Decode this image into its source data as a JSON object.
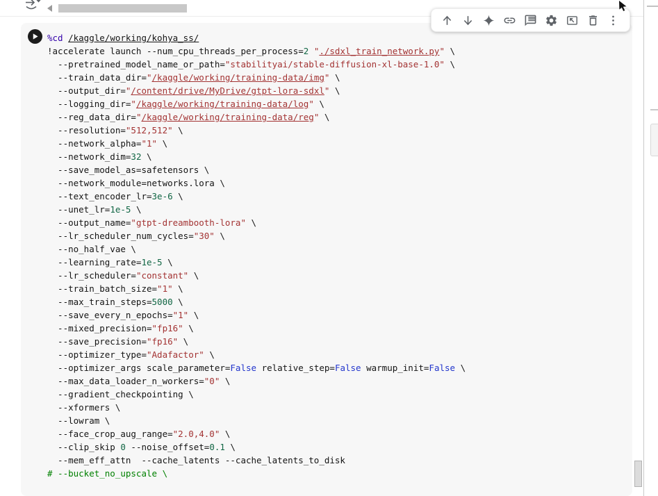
{
  "topbar": {
    "icons": [
      "run-section-arrow-icon",
      "hscroll-left-arrow-icon"
    ]
  },
  "cell_toolbar": {
    "icons": [
      {
        "name": "move-cell-up-icon"
      },
      {
        "name": "move-cell-down-icon"
      },
      {
        "name": "gemini-sparkle-icon"
      },
      {
        "name": "copy-link-icon"
      },
      {
        "name": "add-comment-icon"
      },
      {
        "name": "editor-settings-icon"
      },
      {
        "name": "mirror-cell-icon"
      },
      {
        "name": "delete-cell-icon"
      },
      {
        "name": "more-actions-icon"
      }
    ]
  },
  "colors": {
    "cell_background": "#f7f7f7",
    "icon_gray": "#5f6368",
    "token_string": "#a33333",
    "token_number": "#116644",
    "token_atom": "#2336cc",
    "token_comment": "#008000",
    "token_magic": "#3300aa",
    "token_plain": "#141414"
  },
  "cell": {
    "run_button": "run-cell",
    "code": {
      "lines": [
        [
          {
            "c": "magic",
            "s": "%cd"
          },
          {
            "c": "plain",
            "s": " "
          },
          {
            "c": "plain",
            "u": true,
            "s": "/kaggle/working/kohya_ss/"
          }
        ],
        [
          {
            "c": "plain",
            "s": "!accelerate launch --num_cpu_threads_per_process="
          },
          {
            "c": "number",
            "s": "2"
          },
          {
            "c": "plain",
            "s": " "
          },
          {
            "c": "string",
            "s": "\""
          },
          {
            "c": "string",
            "u": true,
            "s": "./sdxl_train_network.py"
          },
          {
            "c": "string",
            "s": "\""
          },
          {
            "c": "plain",
            "s": " \\"
          }
        ],
        [
          {
            "c": "plain",
            "s": "  --pretrained_model_name_or_path="
          },
          {
            "c": "string",
            "s": "\"stabilityai/stable-diffusion-xl-base-1.0\""
          },
          {
            "c": "plain",
            "s": " \\"
          }
        ],
        [
          {
            "c": "plain",
            "s": "  --train_data_dir="
          },
          {
            "c": "string",
            "s": "\""
          },
          {
            "c": "string",
            "u": true,
            "s": "/kaggle/working/training-data/img"
          },
          {
            "c": "string",
            "s": "\""
          },
          {
            "c": "plain",
            "s": " \\"
          }
        ],
        [
          {
            "c": "plain",
            "s": "  --output_dir="
          },
          {
            "c": "string",
            "s": "\""
          },
          {
            "c": "string",
            "u": true,
            "s": "/content/drive/MyDrive/gtpt-lora-sdxl"
          },
          {
            "c": "string",
            "s": "\""
          },
          {
            "c": "plain",
            "s": " \\"
          }
        ],
        [
          {
            "c": "plain",
            "s": "  --logging_dir="
          },
          {
            "c": "string",
            "s": "\""
          },
          {
            "c": "string",
            "u": true,
            "s": "/kaggle/working/training-data/log"
          },
          {
            "c": "string",
            "s": "\""
          },
          {
            "c": "plain",
            "s": " \\"
          }
        ],
        [
          {
            "c": "plain",
            "s": "  --reg_data_dir="
          },
          {
            "c": "string",
            "s": "\""
          },
          {
            "c": "string",
            "u": true,
            "s": "/kaggle/working/training-data/reg"
          },
          {
            "c": "string",
            "s": "\""
          },
          {
            "c": "plain",
            "s": " \\"
          }
        ],
        [
          {
            "c": "plain",
            "s": "  --resolution="
          },
          {
            "c": "string",
            "s": "\"512,512\""
          },
          {
            "c": "plain",
            "s": " \\"
          }
        ],
        [
          {
            "c": "plain",
            "s": "  --network_alpha="
          },
          {
            "c": "string",
            "s": "\"1\""
          },
          {
            "c": "plain",
            "s": " \\"
          }
        ],
        [
          {
            "c": "plain",
            "s": "  --network_dim="
          },
          {
            "c": "number",
            "s": "32"
          },
          {
            "c": "plain",
            "s": " \\"
          }
        ],
        [
          {
            "c": "plain",
            "s": "  --save_model_as=safetensors \\"
          }
        ],
        [
          {
            "c": "plain",
            "s": "  --network_module=networks.lora \\"
          }
        ],
        [
          {
            "c": "plain",
            "s": "  --text_encoder_lr="
          },
          {
            "c": "number",
            "s": "3e-6"
          },
          {
            "c": "plain",
            "s": " \\"
          }
        ],
        [
          {
            "c": "plain",
            "s": "  --unet_lr="
          },
          {
            "c": "number",
            "s": "1e-5"
          },
          {
            "c": "plain",
            "s": " \\"
          }
        ],
        [
          {
            "c": "plain",
            "s": "  --output_name="
          },
          {
            "c": "string",
            "s": "\"gtpt-dreambooth-lora\""
          },
          {
            "c": "plain",
            "s": " \\"
          }
        ],
        [
          {
            "c": "plain",
            "s": "  --lr_scheduler_num_cycles="
          },
          {
            "c": "string",
            "s": "\"30\""
          },
          {
            "c": "plain",
            "s": " \\"
          }
        ],
        [
          {
            "c": "plain",
            "s": "  --no_half_vae \\"
          }
        ],
        [
          {
            "c": "plain",
            "s": "  --learning_rate="
          },
          {
            "c": "number",
            "s": "1e-5"
          },
          {
            "c": "plain",
            "s": " \\"
          }
        ],
        [
          {
            "c": "plain",
            "s": "  --lr_scheduler="
          },
          {
            "c": "string",
            "s": "\"constant\""
          },
          {
            "c": "plain",
            "s": " \\"
          }
        ],
        [
          {
            "c": "plain",
            "s": "  --train_batch_size="
          },
          {
            "c": "string",
            "s": "\"1\""
          },
          {
            "c": "plain",
            "s": " \\"
          }
        ],
        [
          {
            "c": "plain",
            "s": "  --max_train_steps="
          },
          {
            "c": "number",
            "s": "5000"
          },
          {
            "c": "plain",
            "s": " \\"
          }
        ],
        [
          {
            "c": "plain",
            "s": "  --save_every_n_epochs="
          },
          {
            "c": "string",
            "s": "\"1\""
          },
          {
            "c": "plain",
            "s": " \\"
          }
        ],
        [
          {
            "c": "plain",
            "s": "  --mixed_precision="
          },
          {
            "c": "string",
            "s": "\"fp16\""
          },
          {
            "c": "plain",
            "s": " \\"
          }
        ],
        [
          {
            "c": "plain",
            "s": "  --save_precision="
          },
          {
            "c": "string",
            "s": "\"fp16\""
          },
          {
            "c": "plain",
            "s": " \\"
          }
        ],
        [
          {
            "c": "plain",
            "s": "  --optimizer_type="
          },
          {
            "c": "string",
            "s": "\"Adafactor\""
          },
          {
            "c": "plain",
            "s": " \\"
          }
        ],
        [
          {
            "c": "plain",
            "s": "  --optimizer_args scale_parameter="
          },
          {
            "c": "atom",
            "s": "False"
          },
          {
            "c": "plain",
            "s": " relative_step="
          },
          {
            "c": "atom",
            "s": "False"
          },
          {
            "c": "plain",
            "s": " warmup_init="
          },
          {
            "c": "atom",
            "s": "False"
          },
          {
            "c": "plain",
            "s": " \\"
          }
        ],
        [
          {
            "c": "plain",
            "s": "  --max_data_loader_n_workers="
          },
          {
            "c": "string",
            "s": "\"0\""
          },
          {
            "c": "plain",
            "s": " \\"
          }
        ],
        [
          {
            "c": "plain",
            "s": "  --gradient_checkpointing \\"
          }
        ],
        [
          {
            "c": "plain",
            "s": "  --xformers \\"
          }
        ],
        [
          {
            "c": "plain",
            "s": "  --lowram \\"
          }
        ],
        [
          {
            "c": "plain",
            "s": "  --face_crop_aug_range="
          },
          {
            "c": "string",
            "s": "\"2.0,4.0\""
          },
          {
            "c": "plain",
            "s": " \\"
          }
        ],
        [
          {
            "c": "plain",
            "s": "  --clip_skip "
          },
          {
            "c": "number",
            "s": "0"
          },
          {
            "c": "plain",
            "s": " --noise_offset="
          },
          {
            "c": "number",
            "s": "0.1"
          },
          {
            "c": "plain",
            "s": " \\"
          }
        ],
        [
          {
            "c": "plain",
            "s": "  --mem_eff_attn  --cache_latents --cache_latents_to_disk"
          }
        ],
        [
          {
            "c": "comment",
            "s": "# --bucket_no_upscale \\"
          }
        ]
      ]
    }
  }
}
